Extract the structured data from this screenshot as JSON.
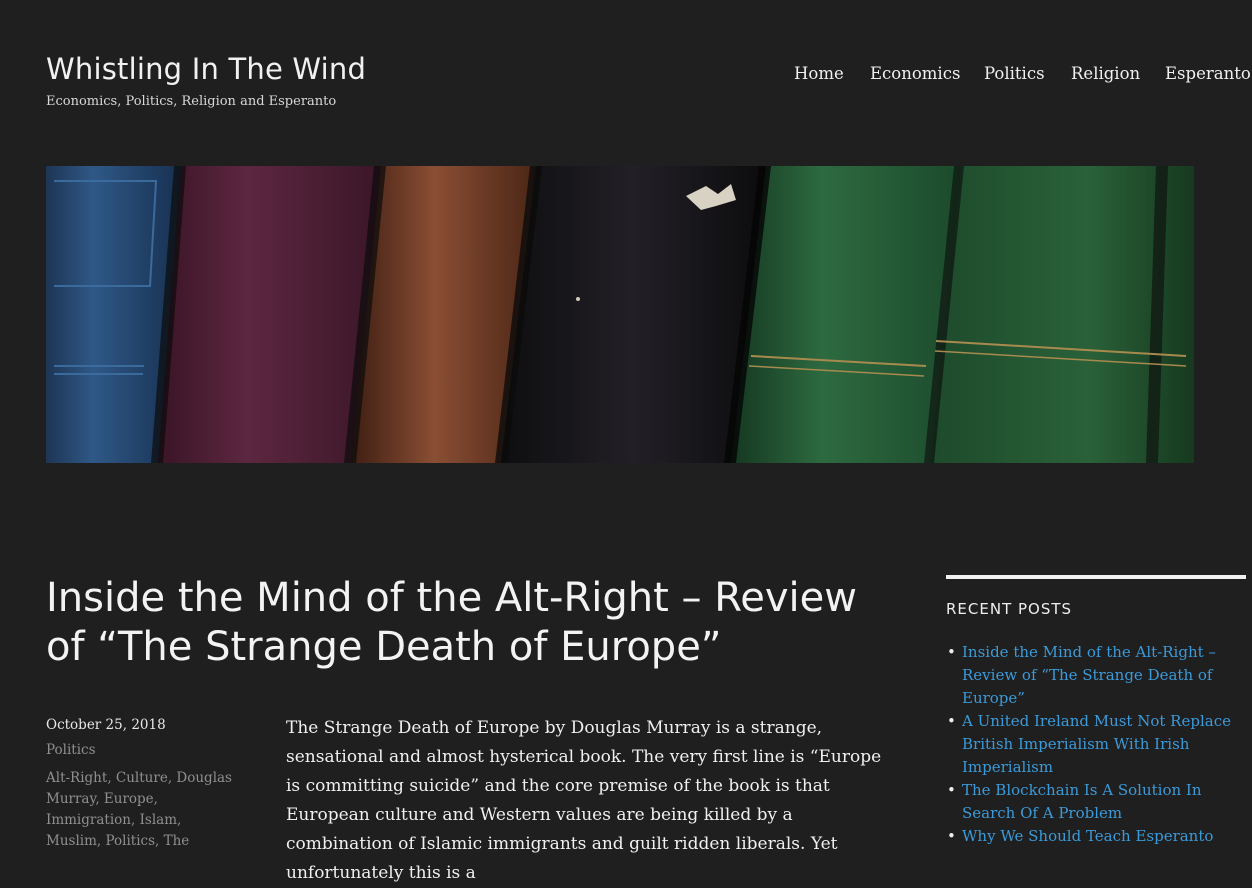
{
  "site": {
    "title": "Whistling In The Wind",
    "tagline": "Economics, Politics, Religion and Esperanto"
  },
  "nav": [
    "Home",
    "Economics",
    "Politics",
    "Religion",
    "Esperanto"
  ],
  "post": {
    "title": "Inside the Mind of the Alt-Right – Review of “The Strange Death of Europe”",
    "date": "October 25, 2018",
    "category": "Politics",
    "tags": [
      "Alt-Right",
      "Culture",
      "Douglas Murray",
      "Europe",
      "Immigration",
      "Islam",
      "Muslim",
      "Politics",
      "The"
    ],
    "body": "The Strange Death of Europe by Douglas Murray is a strange, sensational and almost hysterical book. The very first line is “Europe is committing suicide” and the core premise of the book is that European culture and Western values are being killed by a combination of Islamic immigrants and guilt ridden liberals. Yet unfortunately this is a"
  },
  "sidebar": {
    "widget_title": "RECENT POSTS",
    "recent_posts": [
      "Inside the Mind of the Alt-Right – Review of “The Strange Death of Europe”",
      "A United Ireland Must Not Replace British Imperialism With Irish Imperialism",
      "The Blockchain Is A Solution In Search Of A Problem",
      "Why We Should Teach Esperanto"
    ]
  },
  "colors": {
    "background": "#1f1f1f",
    "text": "#f0f0f0",
    "muted": "#8f8f8f",
    "link": "#3b9ad9"
  }
}
